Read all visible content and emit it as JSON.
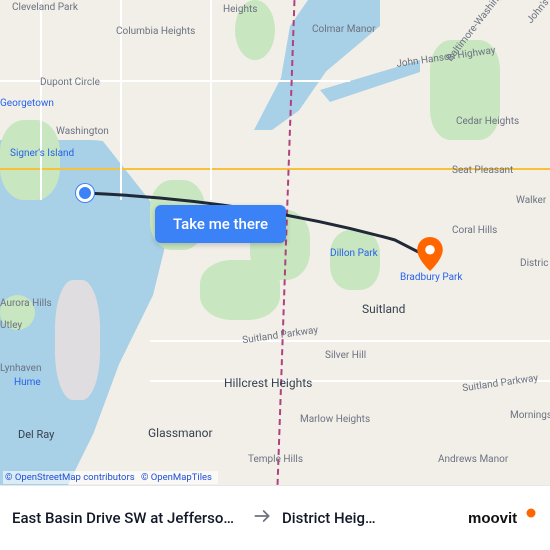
{
  "cta_label": "Take me there",
  "attribution": {
    "osm": "© OpenStreetMap contributors",
    "omt": "© OpenMapTiles"
  },
  "route": {
    "origin_label": "East Basin Drive SW at Jefferson …",
    "dest_label": "District Heig…"
  },
  "brand": {
    "name": "moovit"
  },
  "places": {
    "cleveland_park": "Cleveland Park",
    "columbia_heights": "Columbia Heights",
    "dupont_circle": "Dupont Circle",
    "georgetown": "Georgetown",
    "washington": "Washington",
    "signers_island": "Signer's Island",
    "heights_top": "Heights",
    "colmar_manor": "Colmar Manor",
    "john_hanson": "John Hanson Highway",
    "balt_wash": "Baltimore-Washington",
    "johns": "John's",
    "cedar_heights": "Cedar Heights",
    "seat_pleasant": "Seat Pleasant",
    "walker": "Walker",
    "coral_hills": "Coral Hills",
    "dillon_park": "Dillon Park",
    "bradbury_park": "Bradbury Park",
    "district": "Distric",
    "suitland": "Suitland",
    "suitland_pkwy": "Suitland Parkway",
    "suitland_pkwy2": "Suitland Parkway",
    "silver_hill": "Silver Hill",
    "hillcrest": "Hillcrest Heights",
    "glassmanor": "Glassmanor",
    "marlow_heights": "Marlow Heights",
    "temple_hills": "Temple Hills",
    "andrews_manor": "Andrews Manor",
    "mornings": "Mornings",
    "aurora_hills": "Aurora Hills",
    "utley": "Utley",
    "lynhaven": "Lynhaven",
    "hume": "Hume",
    "del_ray": "Del Ray"
  },
  "colors": {
    "primary": "#3b82f6",
    "dest_marker": "#ff6600",
    "water": "#a8d0e6",
    "park": "#c8e6c0"
  }
}
